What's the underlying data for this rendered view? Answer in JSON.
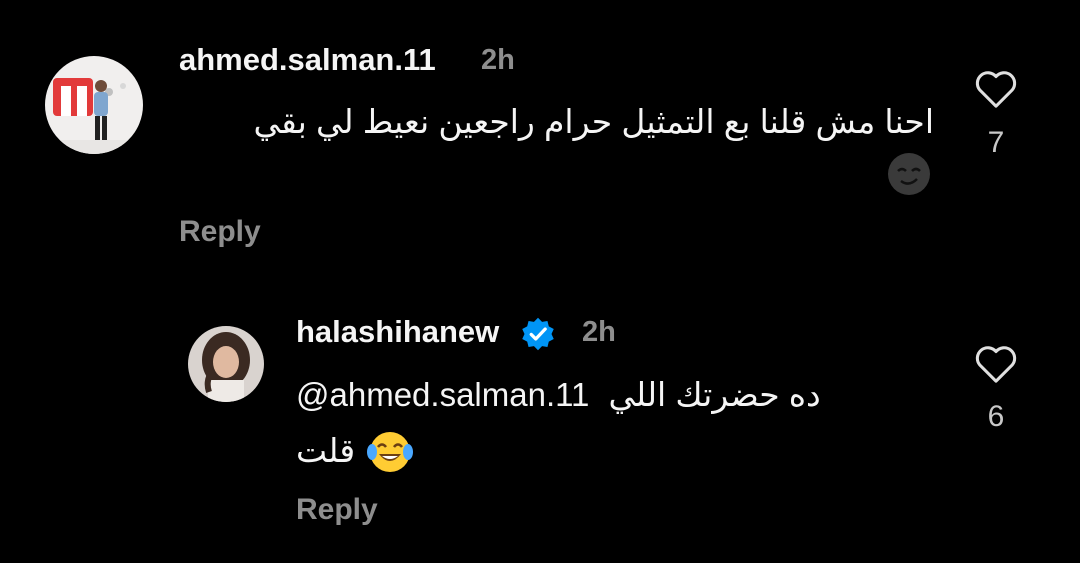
{
  "comments": [
    {
      "username": "ahmed.salman.11",
      "time": "2h",
      "text_line1": "احنا مش قلنا بع التمثيل حرام راجعين نعيط لي بقي",
      "emoji": "smirk-face-emoji",
      "reply_label": "Reply",
      "likes": "7",
      "verified": false,
      "avatar": "profile-photo"
    },
    {
      "username": "halashihanew",
      "time": "2h",
      "text_line1_arabic": "ده حضرتك اللي",
      "mention": "@ahmed.salman.11",
      "text_line2": "قلت",
      "emoji": "face-with-tears-of-joy-emoji",
      "reply_label": "Reply",
      "likes": "6",
      "verified": true,
      "avatar": "profile-photo"
    }
  ],
  "colors": {
    "background": "#000000",
    "text": "#f5f5f5",
    "secondary": "#8e8e8e",
    "verified": "#0095f6"
  },
  "icons": {
    "like": "heart-outline-icon",
    "verified": "verified-badge-icon"
  }
}
